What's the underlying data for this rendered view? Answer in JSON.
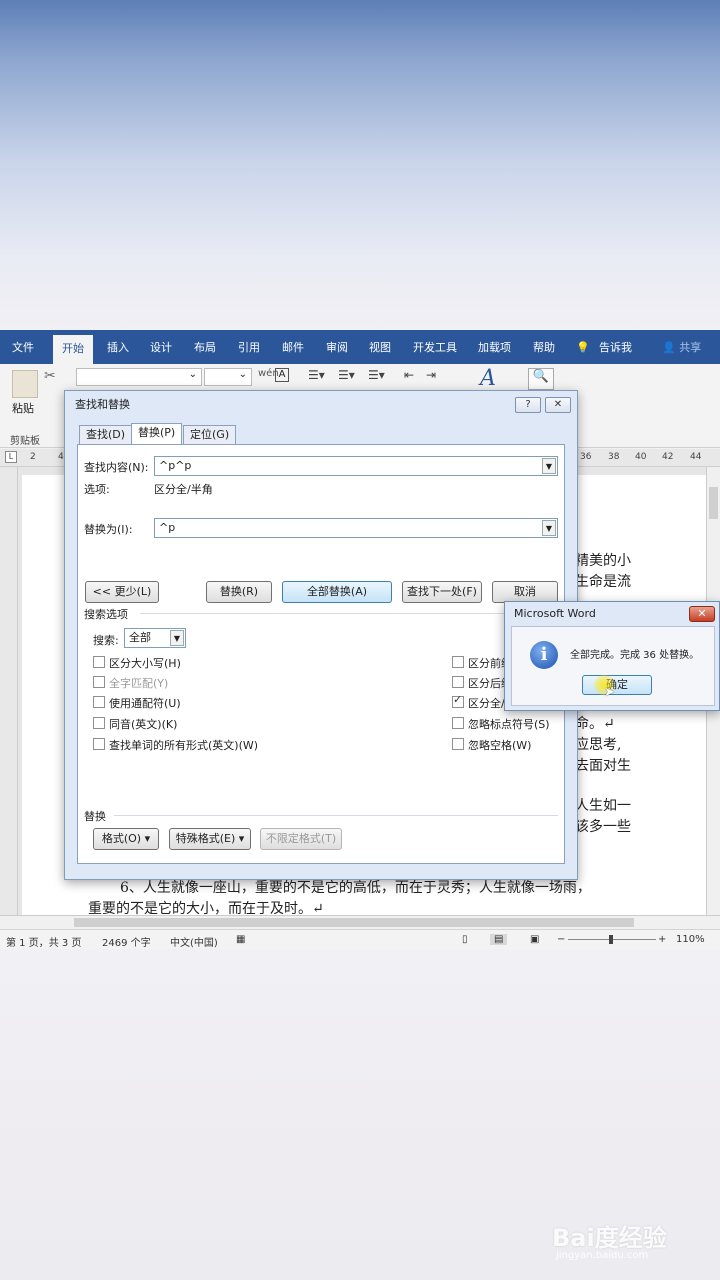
{
  "ribbon": {
    "tabs": [
      "文件",
      "开始",
      "插入",
      "设计",
      "布局",
      "引用",
      "邮件",
      "审阅",
      "视图",
      "开发工具",
      "加载项",
      "帮助"
    ],
    "active_tab": "开始",
    "tell_me": "告诉我",
    "share": "共享",
    "paste_label": "粘贴",
    "clipboard_label": "剪贴板",
    "font_size_glyph": "A"
  },
  "ruler": {
    "left_marker": "L",
    "numbers": [
      "2",
      "4",
      "36",
      "38",
      "40",
      "42",
      "44"
    ]
  },
  "document": {
    "right_fragments": [
      "精美的小",
      "生命是流",
      "命。↵",
      "应思考,",
      "去面对生",
      "人生如一",
      "该多一些"
    ],
    "para6_line1": "6、人生就像一座山，重要的不是它的高低，而在于灵秀；人生就像一场雨，",
    "para6_line2": "重要的不是它的大小，而在于及时。↵"
  },
  "status_bar": {
    "page": "第 1 页，共 3 页",
    "words": "2469 个字",
    "language": "中文(中国)",
    "zoom": "110%"
  },
  "find_replace": {
    "title": "查找和替换",
    "help": "?",
    "tabs": [
      "查找(D)",
      "替换(P)",
      "定位(G)"
    ],
    "active_tab": "替换(P)",
    "find_label": "查找内容(N):",
    "find_value": "^p^p",
    "options_label": "选项:",
    "options_value": "区分全/半角",
    "replace_label": "替换为(I):",
    "replace_value": "^p",
    "less_button": "<< 更少(L)",
    "replace_button": "替换(R)",
    "replace_all_button": "全部替换(A)",
    "find_next_button": "查找下一处(F)",
    "cancel_button": "取消",
    "search_options_label": "搜索选项",
    "search_label": "搜索:",
    "search_value": "全部",
    "left_options": [
      {
        "label": "区分大小写(H)",
        "checked": false,
        "disabled": false
      },
      {
        "label": "全字匹配(Y)",
        "checked": false,
        "disabled": true
      },
      {
        "label": "使用通配符(U)",
        "checked": false,
        "disabled": false
      },
      {
        "label": "同音(英文)(K)",
        "checked": false,
        "disabled": false
      },
      {
        "label": "查找单词的所有形式(英文)(W)",
        "checked": false,
        "disabled": false
      }
    ],
    "right_options": [
      {
        "label": "区分前缀",
        "checked": false
      },
      {
        "label": "区分后缀",
        "checked": false
      },
      {
        "label": "区分全/",
        "checked": true
      },
      {
        "label": "忽略标点符号(S)",
        "checked": false
      },
      {
        "label": "忽略空格(W)",
        "checked": false
      }
    ],
    "replace_section_label": "替换",
    "format_button": "格式(O) ▾",
    "special_button": "特殊格式(E) ▾",
    "no_format_button": "不限定格式(T)"
  },
  "message_box": {
    "title": "Microsoft Word",
    "close": "✕",
    "icon": "information-icon",
    "icon_glyph": "i",
    "text": "全部完成。完成 36 处替换。",
    "ok_button": "确定"
  },
  "watermark": {
    "main": "Bai度经验",
    "sub": "jingyan.baidu.com"
  }
}
